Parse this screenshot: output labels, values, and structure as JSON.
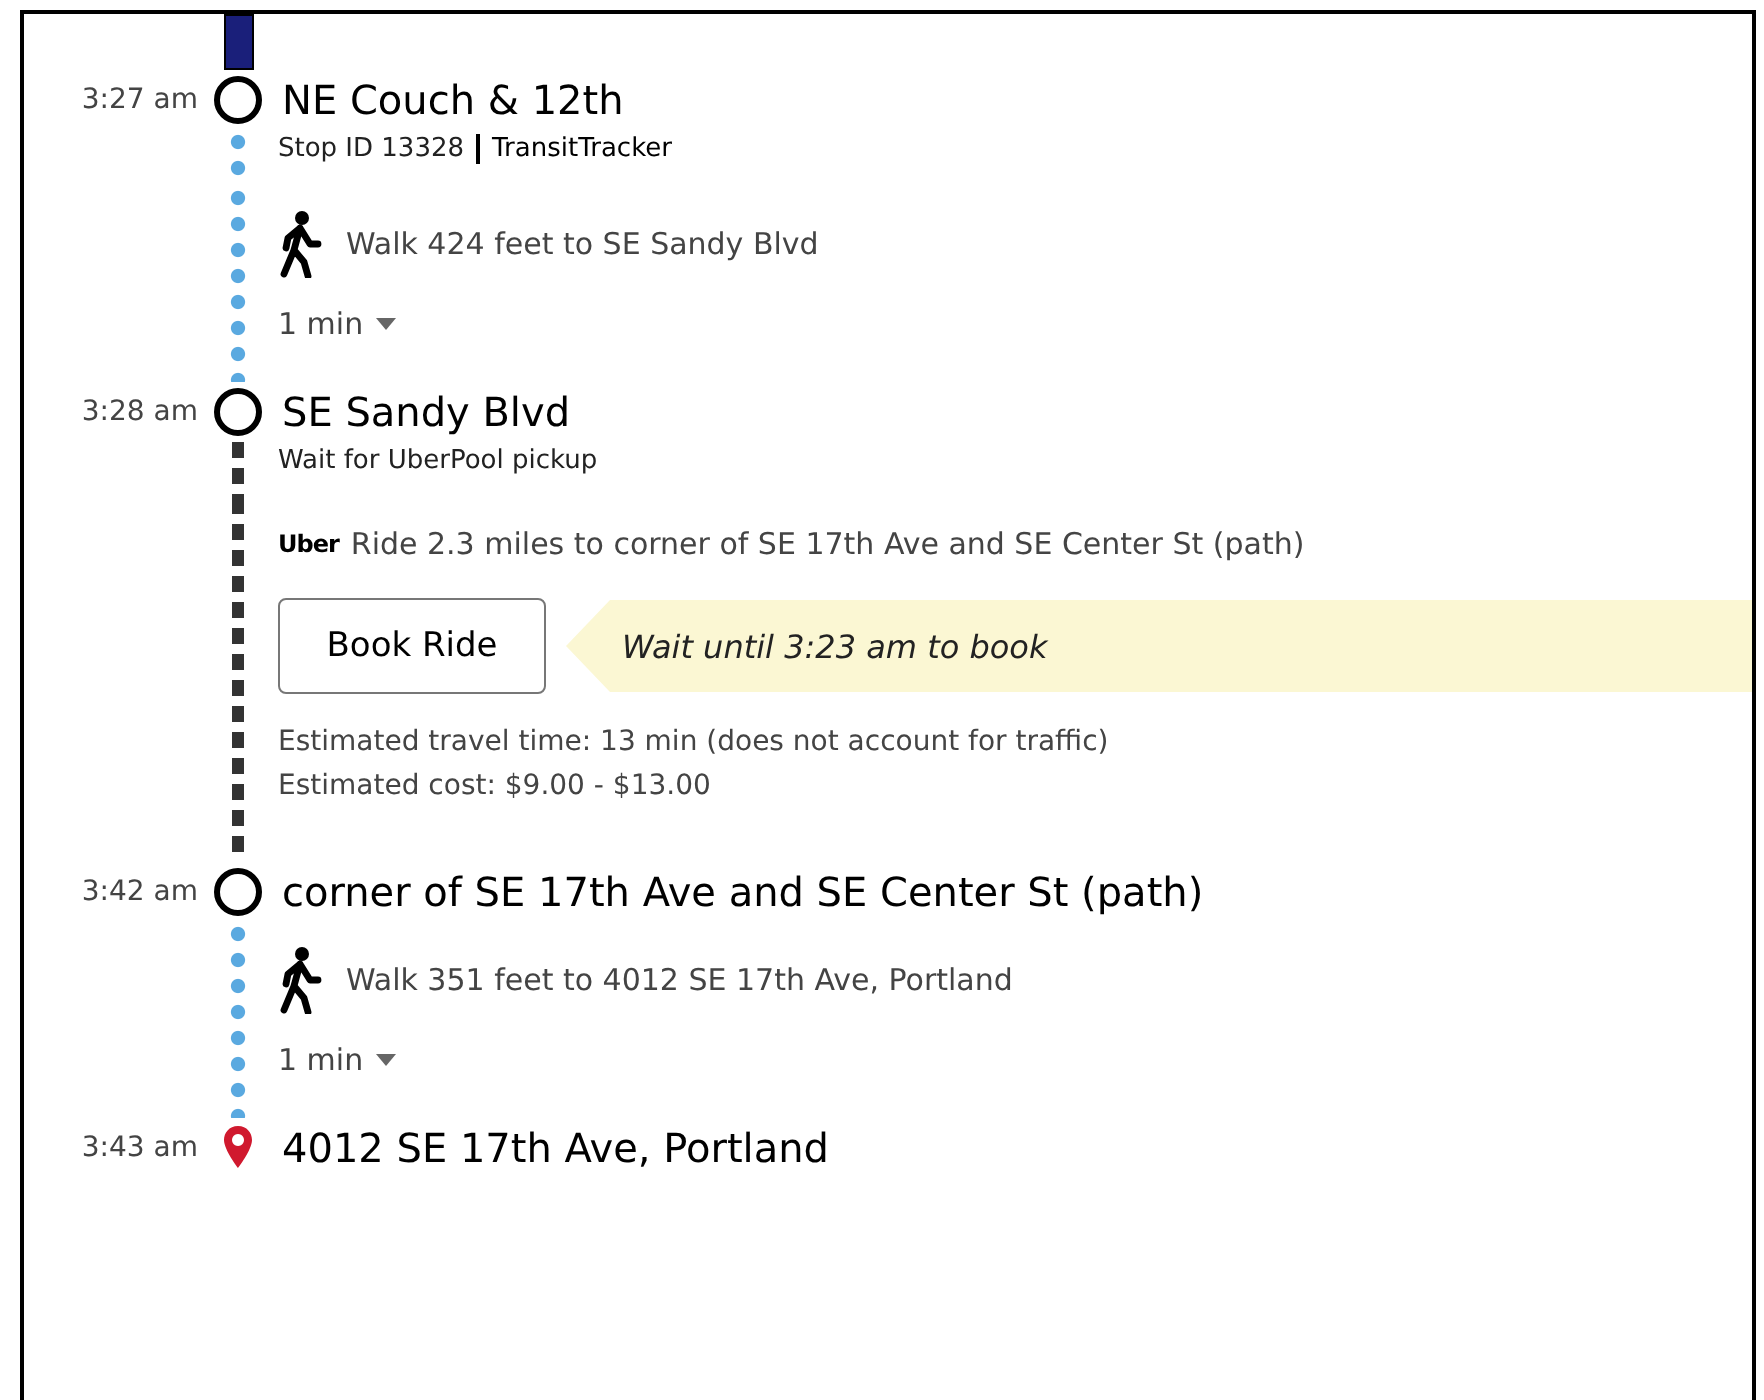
{
  "top_leg": {
    "kind": "transit"
  },
  "timeline": [
    {
      "kind": "stop",
      "time": "3:27 am",
      "name": "NE Couch & 12th",
      "destination": false,
      "stop_id": "Stop ID 13328",
      "link": "TransitTracker"
    },
    {
      "kind": "walk",
      "text": "Walk 424 feet to SE Sandy Blvd",
      "duration": "1 min"
    },
    {
      "kind": "stop",
      "time": "3:28 am",
      "name": "SE Sandy Blvd",
      "destination": false,
      "note": "Wait for UberPool pickup"
    },
    {
      "kind": "ride",
      "provider": "Uber",
      "text": "Ride 2.3 miles to corner of SE 17th Ave and SE Center St (path)",
      "button": "Book Ride",
      "notice": "Wait until 3:23 am to book",
      "estimates": [
        "Estimated travel time: 13 min (does not account for traffic)",
        "Estimated cost: $9.00 - $13.00"
      ]
    },
    {
      "kind": "stop",
      "time": "3:42 am",
      "name": "corner of SE 17th Ave and SE Center St (path)",
      "destination": false
    },
    {
      "kind": "walk",
      "text": "Walk 351 feet to 4012 SE 17th Ave, Portland",
      "duration": "1 min"
    },
    {
      "kind": "stop",
      "time": "3:43 am",
      "name": "4012 SE 17th Ave, Portland",
      "destination": true
    }
  ]
}
